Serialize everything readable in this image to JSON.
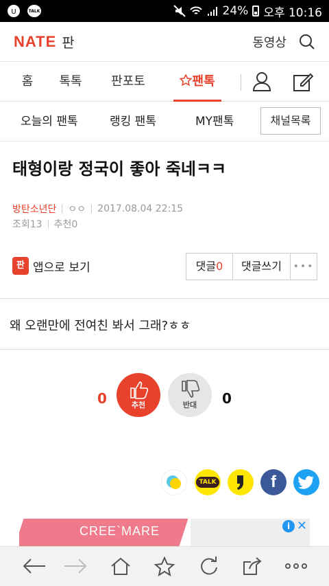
{
  "status": {
    "left_badge": "TALK",
    "battery": "24%",
    "time": "오후 10:16"
  },
  "header": {
    "logo": "NATE",
    "logo_suffix": "판",
    "video_link": "동영상"
  },
  "nav": {
    "items": [
      "홈",
      "톡톡",
      "판포토",
      "팬톡"
    ],
    "active": "팬톡"
  },
  "subnav": {
    "items": [
      "오늘의 팬톡",
      "랭킹 팬톡",
      "MY팬톡"
    ],
    "channel_button": "채널목록"
  },
  "article": {
    "title": "태형이랑 정국이 좋아 죽네ㅋㅋ",
    "author": "방탄소년단",
    "author_suffix": "ㅇㅇ",
    "datetime": "2017.08.04 22:15",
    "views": "조회13",
    "recommends": "추천0",
    "app_view": "앱으로 보기",
    "app_icon": "판",
    "comment_label": "댓글",
    "comment_count": "0",
    "write_comment": "댓글쓰기",
    "more": "•••",
    "body": "왜 오랜만에 전여친 봐서 그래?ㅎㅎ"
  },
  "votes": {
    "up_count": "0",
    "up_label": "추천",
    "down_label": "반대",
    "down_count": "0"
  },
  "share": {
    "kakao_talk_label": "TALK"
  },
  "ad": {
    "text": "CREE`MARE",
    "info": "i",
    "close": "✕"
  },
  "colors": {
    "accent": "#e8412c",
    "facebook": "#3b5998",
    "twitter": "#1da1f2",
    "kakao": "#ffe600"
  }
}
